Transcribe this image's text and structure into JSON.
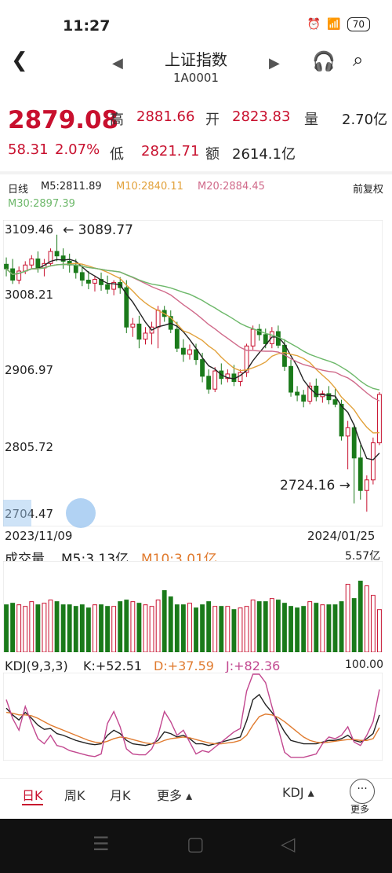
{
  "status": {
    "time": "11:27",
    "battery": "70"
  },
  "header": {
    "title": "上证指数",
    "code": "1A0001"
  },
  "quote": {
    "price": "2879.08",
    "change": "58.31",
    "change_pct": "2.07%",
    "high_label": "高",
    "high": "2881.66",
    "open_label": "开",
    "open": "2823.83",
    "vol_label": "量",
    "vol": "2.70亿",
    "low_label": "低",
    "low": "2821.71",
    "amount_label": "额",
    "amount": "2614.1亿"
  },
  "ma": {
    "period": "日线",
    "m5": "M5:2811.89",
    "m10": "M10:2840.11",
    "m20": "M20:2884.45",
    "m30": "M30:2897.39",
    "adjust": "前复权"
  },
  "price_axis": {
    "t1": "3109.46",
    "t2": "3008.21",
    "t3": "2906.97",
    "t4": "2805.72",
    "t5": "2704.47",
    "max_ann": "3089.77",
    "min_ann": "2724.16",
    "date_start": "2023/11/09",
    "date_end": "2024/01/25"
  },
  "volume": {
    "label": "成交量",
    "m5": "M5:3.13亿",
    "m10": "M10:3.01亿",
    "max": "5.57亿"
  },
  "kdj": {
    "label": "KDJ(9,3,3)",
    "k": "K:+52.51",
    "d": "D:+37.59",
    "j": "J:+82.36",
    "max": "100.00"
  },
  "tabs": {
    "day": "日K",
    "week": "周K",
    "month": "月K",
    "more": "更多",
    "indicator": "KDJ",
    "more2": "更多"
  },
  "colors": {
    "up": "#c8102e",
    "down": "#1a7a1a",
    "m5": "#222222",
    "m10": "#e2a13a",
    "m20": "#d06a8a",
    "m30": "#6db86a",
    "k": "#222222",
    "d": "#e07b2f",
    "j": "#c2478f"
  },
  "chart_data": [
    {
      "type": "candlestick",
      "title": "上证指数 日线",
      "x_range": [
        "2023/11/09",
        "2024/01/25"
      ],
      "ylim": [
        2704.47,
        3109.46
      ],
      "annotations": [
        {
          "text": "3089.77",
          "kind": "max"
        },
        {
          "text": "2724.16",
          "kind": "min"
        }
      ],
      "candles": [
        [
          3051,
          3060,
          3035,
          3045
        ],
        [
          3045,
          3058,
          3025,
          3030
        ],
        [
          3030,
          3048,
          3025,
          3042
        ],
        [
          3042,
          3055,
          3038,
          3050
        ],
        [
          3050,
          3063,
          3045,
          3058
        ],
        [
          3058,
          3068,
          3040,
          3046
        ],
        [
          3046,
          3058,
          3035,
          3052
        ],
        [
          3052,
          3072,
          3048,
          3068
        ],
        [
          3068,
          3090,
          3055,
          3062
        ],
        [
          3062,
          3072,
          3045,
          3055
        ],
        [
          3055,
          3065,
          3040,
          3050
        ],
        [
          3050,
          3058,
          3032,
          3040
        ],
        [
          3040,
          3050,
          3022,
          3030
        ],
        [
          3030,
          3042,
          3018,
          3026
        ],
        [
          3026,
          3036,
          3015,
          3031
        ],
        [
          3031,
          3040,
          3016,
          3024
        ],
        [
          3024,
          3036,
          3012,
          3018
        ],
        [
          3018,
          3030,
          3010,
          3027
        ],
        [
          3027,
          3034,
          3012,
          3020
        ],
        [
          3020,
          3030,
          2960,
          2968
        ],
        [
          2968,
          2980,
          2955,
          2972
        ],
        [
          2972,
          2983,
          2940,
          2952
        ],
        [
          2952,
          2968,
          2945,
          2960
        ],
        [
          2960,
          2975,
          2945,
          2968
        ],
        [
          2968,
          2996,
          2940,
          2990
        ],
        [
          2990,
          2996,
          2975,
          2982
        ],
        [
          2982,
          2990,
          2960,
          2965
        ],
        [
          2965,
          2975,
          2935,
          2940
        ],
        [
          2940,
          2952,
          2922,
          2932
        ],
        [
          2932,
          2945,
          2925,
          2938
        ],
        [
          2938,
          2946,
          2918,
          2925
        ],
        [
          2925,
          2934,
          2895,
          2903
        ],
        [
          2903,
          2912,
          2880,
          2886
        ],
        [
          2886,
          2915,
          2882,
          2910
        ],
        [
          2910,
          2920,
          2892,
          2900
        ],
        [
          2900,
          2912,
          2895,
          2906
        ],
        [
          2906,
          2918,
          2890,
          2896
        ],
        [
          2896,
          2912,
          2890,
          2908
        ],
        [
          2908,
          2946,
          2902,
          2943
        ],
        [
          2943,
          2970,
          2938,
          2965
        ],
        [
          2965,
          2972,
          2950,
          2958
        ],
        [
          2958,
          2966,
          2940,
          2946
        ],
        [
          2946,
          2968,
          2940,
          2962
        ],
        [
          2962,
          2970,
          2940,
          2944
        ],
        [
          2944,
          2952,
          2910,
          2916
        ],
        [
          2916,
          2925,
          2876,
          2882
        ],
        [
          2882,
          2890,
          2870,
          2878
        ],
        [
          2878,
          2885,
          2862,
          2870
        ],
        [
          2870,
          2895,
          2866,
          2890
        ],
        [
          2890,
          2900,
          2870,
          2876
        ],
        [
          2876,
          2884,
          2868,
          2880
        ],
        [
          2880,
          2890,
          2866,
          2872
        ],
        [
          2872,
          2886,
          2862,
          2866
        ],
        [
          2866,
          2872,
          2818,
          2824
        ],
        [
          2824,
          2844,
          2780,
          2835
        ],
        [
          2835,
          2840,
          2735,
          2795
        ],
        [
          2795,
          2812,
          2740,
          2752
        ],
        [
          2752,
          2772,
          2724,
          2766
        ],
        [
          2766,
          2822,
          2760,
          2815
        ],
        [
          2815,
          2882,
          2812,
          2879
        ]
      ]
    },
    {
      "type": "bar",
      "title": "成交量",
      "ylim": [
        0,
        5.57
      ],
      "values": [
        3.0,
        3.1,
        3.0,
        2.9,
        3.2,
        3.0,
        3.1,
        3.3,
        3.2,
        3.0,
        3.0,
        2.9,
        3.0,
        2.8,
        3.0,
        3.0,
        2.9,
        2.9,
        3.2,
        3.3,
        3.2,
        3.1,
        3.0,
        2.9,
        3.3,
        3.9,
        3.5,
        3.0,
        3.0,
        3.1,
        2.8,
        3.0,
        3.2,
        2.9,
        2.9,
        2.9,
        2.7,
        2.8,
        2.9,
        3.3,
        3.2,
        3.2,
        3.4,
        3.3,
        3.1,
        2.9,
        2.8,
        2.9,
        3.2,
        3.1,
        3.0,
        3.0,
        3.0,
        3.2,
        4.3,
        3.4,
        4.5,
        4.2,
        3.6,
        2.7
      ]
    },
    {
      "type": "line",
      "title": "KDJ(9,3,3)",
      "ylim": [
        0,
        100
      ],
      "series": [
        {
          "name": "K",
          "values": [
            60,
            52,
            46,
            55,
            48,
            40,
            35,
            36,
            30,
            28,
            25,
            22,
            20,
            18,
            17,
            18,
            28,
            34,
            30,
            22,
            18,
            17,
            16,
            18,
            22,
            32,
            30,
            26,
            28,
            24,
            18,
            18,
            16,
            18,
            20,
            22,
            24,
            26,
            45,
            70,
            76,
            64,
            55,
            45,
            32,
            22,
            20,
            18,
            18,
            18,
            20,
            22,
            22,
            24,
            28,
            22,
            20,
            24,
            30,
            52
          ]
        },
        {
          "name": "D",
          "values": [
            55,
            54,
            52,
            52,
            51,
            48,
            44,
            40,
            37,
            34,
            31,
            28,
            25,
            22,
            20,
            19,
            21,
            24,
            26,
            25,
            23,
            21,
            19,
            18,
            19,
            22,
            24,
            25,
            26,
            25,
            23,
            21,
            19,
            18,
            18,
            19,
            20,
            22,
            28,
            40,
            50,
            53,
            52,
            49,
            44,
            38,
            32,
            26,
            22,
            20,
            19,
            20,
            21,
            22,
            23,
            23,
            22,
            22,
            24,
            37
          ]
        },
        {
          "name": "J",
          "values": [
            70,
            48,
            34,
            62,
            42,
            24,
            18,
            28,
            16,
            14,
            10,
            8,
            6,
            4,
            3,
            6,
            42,
            56,
            38,
            12,
            6,
            5,
            5,
            12,
            28,
            56,
            44,
            28,
            34,
            20,
            6,
            10,
            8,
            14,
            20,
            26,
            32,
            36,
            80,
            100,
            100,
            90,
            62,
            36,
            8,
            2,
            2,
            2,
            4,
            6,
            18,
            26,
            24,
            28,
            38,
            20,
            16,
            28,
            44,
            82
          ]
        }
      ]
    }
  ]
}
